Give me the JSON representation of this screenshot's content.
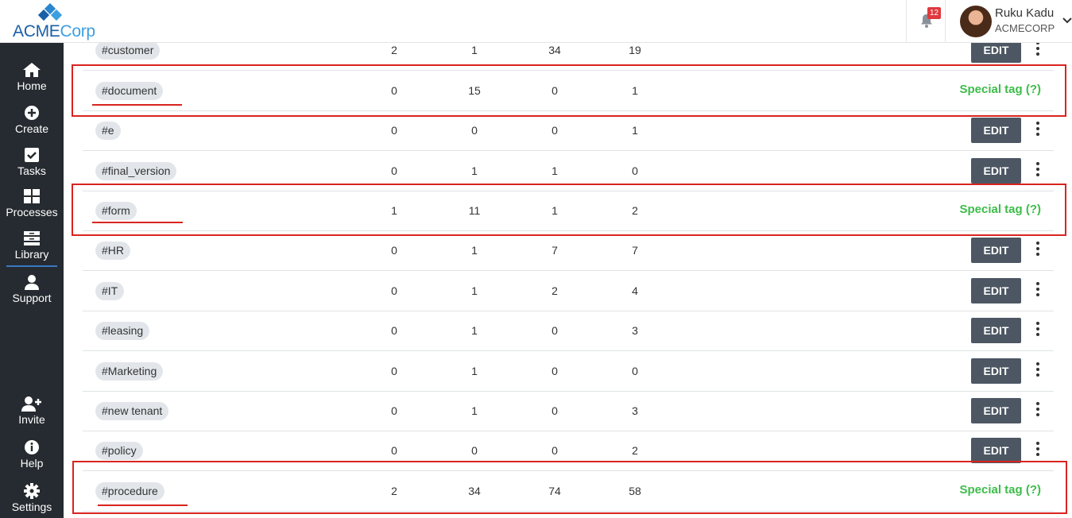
{
  "header": {
    "logo_part1": "ACME",
    "logo_part2": "Corp",
    "notification_count": "12",
    "user_name": "Ruku Kadu",
    "user_org": "ACMECORP"
  },
  "sidebar": {
    "top": [
      {
        "label": "Home",
        "icon": "home-icon"
      },
      {
        "label": "Create",
        "icon": "plus-circle-icon"
      },
      {
        "label": "Tasks",
        "icon": "checkbox-icon"
      },
      {
        "label": "Processes",
        "icon": "grid-icon"
      },
      {
        "label": "Library",
        "icon": "library-icon"
      },
      {
        "label": "Support",
        "icon": "person-icon"
      }
    ],
    "bottom": [
      {
        "label": "Invite",
        "icon": "user-plus-icon"
      },
      {
        "label": "Help",
        "icon": "info-icon"
      },
      {
        "label": "Settings",
        "icon": "gear-icon"
      }
    ]
  },
  "colors": {
    "sidebar_bg": "#252b30",
    "edit_button": "#4d5763",
    "special_tag": "#3dbc4a",
    "highlight": "#d9241f"
  },
  "tag_rows": [
    {
      "tag": "#customer",
      "v1": "2",
      "v2": "1",
      "v3": "34",
      "v4": "19",
      "special": false,
      "action": "EDIT"
    },
    {
      "tag": "#document",
      "v1": "0",
      "v2": "15",
      "v3": "0",
      "v4": "1",
      "special": true,
      "special_label": "Special tag (?)"
    },
    {
      "tag": "#e",
      "v1": "0",
      "v2": "0",
      "v3": "0",
      "v4": "1",
      "special": false,
      "action": "EDIT"
    },
    {
      "tag": "#final_version",
      "v1": "0",
      "v2": "1",
      "v3": "1",
      "v4": "0",
      "special": false,
      "action": "EDIT"
    },
    {
      "tag": "#form",
      "v1": "1",
      "v2": "11",
      "v3": "1",
      "v4": "2",
      "special": true,
      "special_label": "Special tag (?)"
    },
    {
      "tag": "#HR",
      "v1": "0",
      "v2": "1",
      "v3": "7",
      "v4": "7",
      "special": false,
      "action": "EDIT"
    },
    {
      "tag": "#IT",
      "v1": "0",
      "v2": "1",
      "v3": "2",
      "v4": "4",
      "special": false,
      "action": "EDIT"
    },
    {
      "tag": "#leasing",
      "v1": "0",
      "v2": "1",
      "v3": "0",
      "v4": "3",
      "special": false,
      "action": "EDIT"
    },
    {
      "tag": "#Marketing",
      "v1": "0",
      "v2": "1",
      "v3": "0",
      "v4": "0",
      "special": false,
      "action": "EDIT"
    },
    {
      "tag": "#new tenant",
      "v1": "0",
      "v2": "1",
      "v3": "0",
      "v4": "3",
      "special": false,
      "action": "EDIT"
    },
    {
      "tag": "#policy",
      "v1": "0",
      "v2": "0",
      "v3": "0",
      "v4": "2",
      "special": false,
      "action": "EDIT"
    },
    {
      "tag": "#procedure",
      "v1": "2",
      "v2": "34",
      "v3": "74",
      "v4": "58",
      "special": true,
      "special_label": "Special tag (?)"
    }
  ]
}
